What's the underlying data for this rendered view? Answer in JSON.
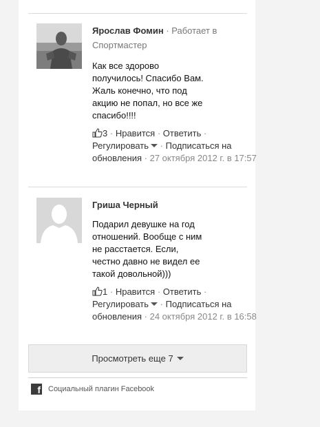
{
  "comments": [
    {
      "author": "Ярослав Фомин",
      "separator": " · ",
      "work_prefix": "Работает в",
      "work_place": "Спортмастер",
      "text": "Как все здорово\nполучилось! Спасибо Вам.\nЖаль конечно, что под\nакцию не попал, но все же\nспасибо!!!!",
      "likes": "3",
      "like_label": "Нравится",
      "reply_label": "Ответить",
      "adjust_label": "Регулировать",
      "subscribe_label": "Подписаться на обновления",
      "date": "27 октября 2012 г. в 17:57",
      "avatar_icon": "user-photo-avatar"
    },
    {
      "author": "Гриша Черный",
      "text": "Подарил девушке на год\nотношений. Вообще с ним\nне расстается. Если,\nчестно давно не видел ее\nтакой довольной)))",
      "likes": "1",
      "like_label": "Нравится",
      "reply_label": "Ответить",
      "adjust_label": "Регулировать",
      "subscribe_label": "Подписаться на обновления",
      "date": "24 октября 2012 г. в 16:58",
      "avatar_icon": "default-silhouette-avatar"
    }
  ],
  "more_button": {
    "label": "Просмотреть еще 7"
  },
  "footer": {
    "icon": "facebook-icon",
    "label": "Социальный плагин Facebook"
  },
  "colors": {
    "text": "#1a1a1a",
    "meta": "#777777",
    "button_bg": "#eeeeee",
    "divider": "#dadada"
  }
}
